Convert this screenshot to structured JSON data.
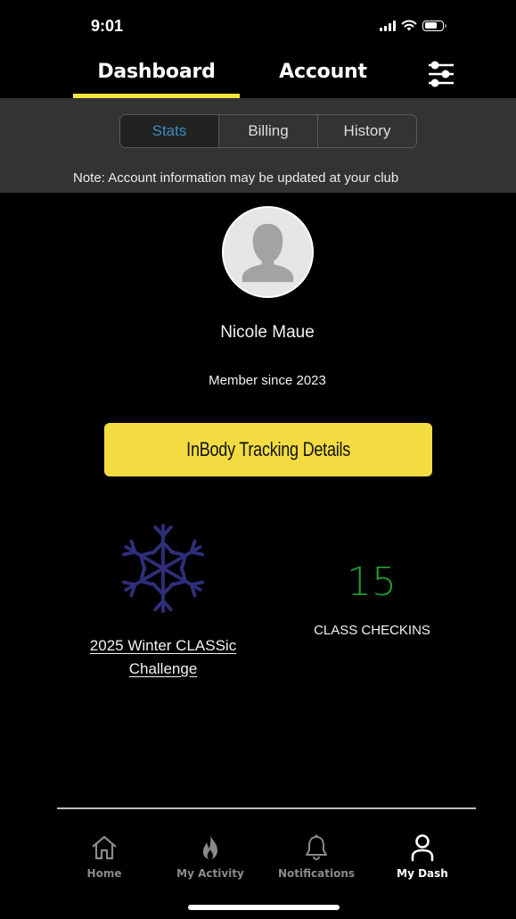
{
  "status_bar": {
    "time": "9:01",
    "icons": [
      "signal-icon",
      "wifi-icon",
      "battery-icon"
    ]
  },
  "top_tabs": {
    "items": [
      {
        "label": "Dashboard",
        "active": true
      },
      {
        "label": "Account",
        "active": false
      }
    ],
    "settings_icon": "sliders-icon",
    "accent_color": "#f3e53a"
  },
  "sub_tabs": {
    "items": [
      {
        "label": "Stats",
        "active": true
      },
      {
        "label": "Billing",
        "active": false
      },
      {
        "label": "History",
        "active": false
      }
    ],
    "active_color": "#3d8bc4"
  },
  "note": "Note: Account information may be updated at your club",
  "profile": {
    "name": "Nicole Maue",
    "member_since": "Member since 2023",
    "avatar": "default-person-avatar"
  },
  "inbody_button": {
    "label": "InBody Tracking Details",
    "color": "#f3dc41"
  },
  "challenge": {
    "icon": "snowflake-icon",
    "icon_color": "#2e2e7a",
    "line1": "2025 Winter CLASSic",
    "line2": "Challenge"
  },
  "checkins": {
    "count": "15",
    "label": "CLASS CHECKINS",
    "count_color": "#1f9a2e"
  },
  "bottom_nav": {
    "items": [
      {
        "label": "Home",
        "icon": "home-icon",
        "active": false
      },
      {
        "label": "My Activity",
        "icon": "flame-icon",
        "active": false
      },
      {
        "label": "Notifications",
        "icon": "bell-icon",
        "active": false
      },
      {
        "label": "My Dash",
        "icon": "person-icon",
        "active": true
      }
    ]
  }
}
